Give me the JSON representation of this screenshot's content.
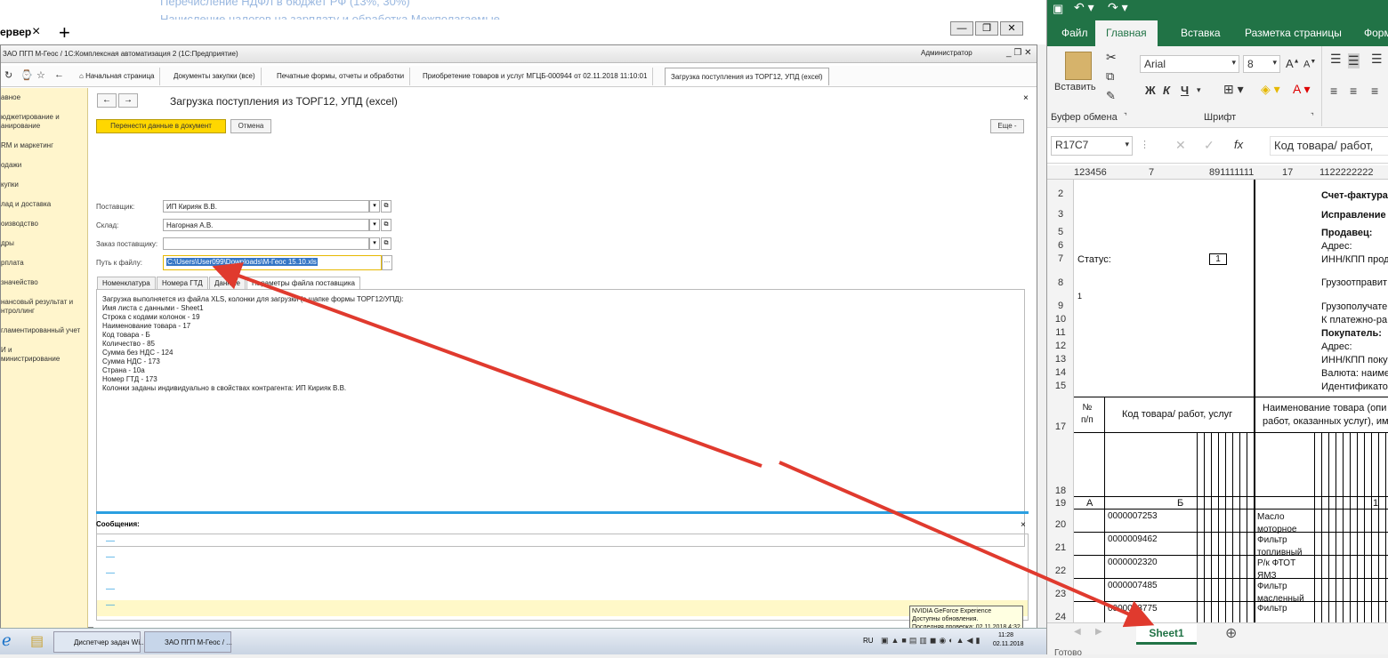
{
  "background": {
    "line1": "Перечисление НДФЛ в бюджет РФ (13%, 30%)",
    "line2": "Начисление налогов на зарплату и обработка Межполагаемые"
  },
  "browser": {
    "tab_label": "ервер",
    "close": "×",
    "new_tab": "+"
  },
  "onec": {
    "window_title": "ЗАО ПГП М-Геос / 1С:Комплексная автоматизация 2 (1С:Предприятие)",
    "user": "Администратор",
    "tabs": [
      "Начальная страница",
      "Документы закупки (все)",
      "Печатные формы, отчеты и обработки",
      "Приобретение товаров и услуг МГЦБ-000944 от 02.11.2018 11:10:01",
      "Загрузка поступления из ТОРГ12, УПД (excel)"
    ],
    "sidebar": [
      "авное",
      "юджетирование и\nанирование",
      "RМ и маркетинг",
      "одажи",
      "купки",
      "лад и доставка",
      "оизводство",
      "дры",
      "рплата",
      "значейство",
      "нансовый результат и\nнтроллинг",
      "гламентированный учет",
      "И и\nминистрирование"
    ],
    "form_title": "Загрузка поступления из ТОРГ12, УПД (excel)",
    "buttons": {
      "transfer": "Перенести данные в документ",
      "cancel": "Отмена",
      "more": "Еще -"
    },
    "fields": {
      "supplier_label": "Поставщик:",
      "supplier_value": "ИП Кирияк В.В.",
      "warehouse_label": "Склад:",
      "warehouse_value": "Нагорная А.В.",
      "order_label": "Заказ поставщику:",
      "order_value": "",
      "path_label": "Путь к файлу:",
      "path_value": "C:\\Users\\User099\\Downloads\\М-Геос 15.10.xls"
    },
    "subtabs": [
      "Номенклатура",
      "Номера ГТД",
      "Данные",
      "Параметры файла поставщика"
    ],
    "info_lines": [
      "Загрузка выполняется из файла XLS, колонки для загрузки (в шапке формы ТОРГ12/УПД):",
      "Имя листа с данными - Sheet1",
      "Строка с кодами колонок - 19",
      "Наименование товара - 17",
      "Код товара - Б",
      "Количество - 85",
      "Сумма без НДС - 124",
      "Сумма НДС - 173",
      "Страна - 10а",
      "Номер ГТД - 173",
      "Колонки заданы индивидуально в свойствах контрагента: ИП Кирияк В.В."
    ],
    "messages_title": "Сообщения:",
    "messages": [
      "—",
      "—",
      "—",
      "—",
      "—"
    ]
  },
  "taskbar": {
    "item1": "Диспетчер задач Wi...",
    "item2": "ЗАО ПГП М-Геос / ...",
    "lang": "RU",
    "time": "11:28",
    "date": "02.11.2018",
    "tooltip": [
      "NVIDIA GeForce Experience",
      "Доступны обновления.",
      "Последняя проверка: 02.11.2018 4:32"
    ]
  },
  "excel": {
    "tabs": [
      "Файл",
      "Главная",
      "Вставка",
      "Разметка страницы",
      "Форм"
    ],
    "paste_label": "Вставить",
    "clipboard_label": "Буфер обмена",
    "font_label": "Шрифт",
    "font_name": "Arial",
    "font_size": "8",
    "bold": "Ж",
    "italic": "К",
    "underline": "Ч",
    "name_box": "R17C7",
    "formula": "Код товара/ работ,",
    "fx": "fx",
    "col_headers": [
      "1",
      "2",
      "3",
      "4",
      "5",
      "6",
      "7",
      "8",
      "9",
      "1",
      "1",
      "1",
      "1",
      "1",
      "1",
      "1",
      "17",
      "1",
      "1",
      "2",
      "2",
      "2",
      "2",
      "2",
      "2",
      "2",
      "2"
    ],
    "rows": [
      "2",
      "3",
      "5",
      "6",
      "7",
      "8",
      "9",
      "10",
      "11",
      "12",
      "13",
      "14",
      "15",
      "17",
      "18",
      "19",
      "20",
      "21",
      "22",
      "23",
      "24"
    ],
    "cells": {
      "invoice": "Счет-фактура",
      "correction": "Исправление",
      "seller": "Продавец:",
      "address": "Адрес:",
      "status": "Статус:",
      "status_val": "1",
      "inn_seller": "ИНН/КПП прода",
      "shipper": "Грузоотправит",
      "consignee": "Грузополучате",
      "payment": "К платежно-ра",
      "buyer": "Покупатель:",
      "address2": "Адрес:",
      "inn_buyer": "ИНН/КПП покуп",
      "currency": "Валюта: наиме",
      "identifier": "Идентификато",
      "col_no": "№\nп/п",
      "col_code": "Код товара/ работ, услуг",
      "col_name": "Наименование товара (опи\nработ, оказанных услуг), им",
      "row19_a": "А",
      "row19_b": "Б",
      "row19_1": "1",
      "row9_mark": "1",
      "codes": [
        "0000007253",
        "0000009462",
        "0000002320",
        "0000007485",
        "0000003775"
      ],
      "names": [
        "Масло\nмоторное",
        "Фильтр\nтопливный",
        "Р/к ФТОТ\nЯМЗ",
        "Фильтр\nмасленный",
        "Фильтр"
      ]
    },
    "sheet": "Sheet1",
    "status_bar": "Готово"
  },
  "colors": {
    "excel_green": "#217346",
    "onec_yellow": "#ffd700",
    "arrow_red": "#e03a2e"
  }
}
